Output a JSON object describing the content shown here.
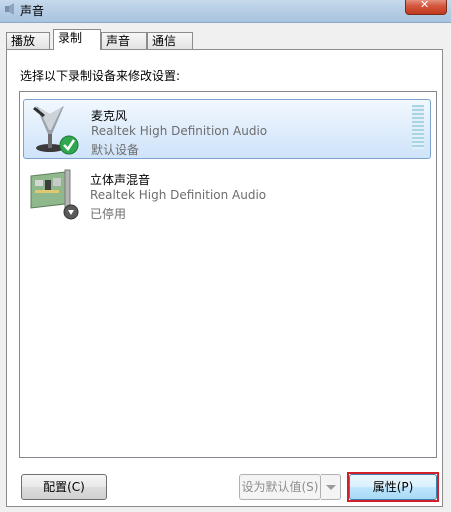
{
  "window": {
    "title": "声音"
  },
  "tabs": [
    {
      "label": "播放"
    },
    {
      "label": "录制"
    },
    {
      "label": "声音"
    },
    {
      "label": "通信"
    }
  ],
  "active_tab": "录制",
  "instruction": "选择以下录制设备来修改设置:",
  "devices": [
    {
      "name": "麦克风",
      "driver": "Realtek High Definition Audio",
      "status": "默认设备",
      "icon": "microphone-icon",
      "badge": "green-check-icon",
      "selected": true
    },
    {
      "name": "立体声混音",
      "driver": "Realtek High Definition Audio",
      "status": "已停用",
      "icon": "sound-card-icon",
      "badge": "disabled-arrow-icon",
      "selected": false
    }
  ],
  "buttons": {
    "configure": "配置(C)",
    "set_default": "设为默认值(S)",
    "properties": "属性(P)"
  },
  "colors": {
    "highlight": "#d0212b",
    "selection": "#cfe3fa"
  }
}
